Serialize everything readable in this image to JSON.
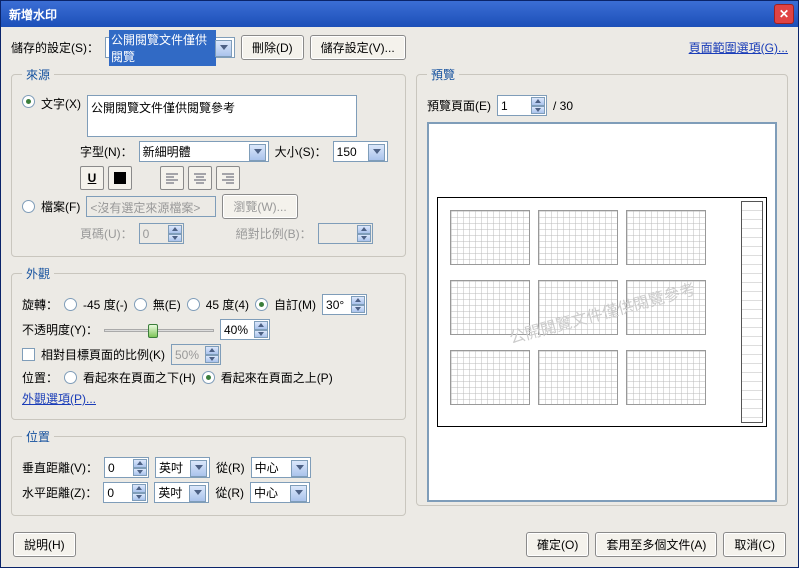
{
  "title": "新增水印",
  "topbar": {
    "saved_label": "儲存的設定(S)：",
    "saved_value": "公開閱覽文件僅供閱覽",
    "delete_btn": "刪除(D)",
    "save_btn": "儲存設定(V)...",
    "page_range_link": "頁面範圍選項(G)..."
  },
  "source": {
    "legend": "來源",
    "text_radio": "文字(X)",
    "text_value": "公開閱覽文件僅供閱覽參考",
    "font_label": "字型(N)：",
    "font_value": "新細明體",
    "size_label": "大小(S)：",
    "size_value": "150",
    "file_radio": "檔案(F)",
    "file_value": "<沒有選定來源檔案>",
    "browse_btn": "瀏覽(W)...",
    "page_label": "頁碼(U)：",
    "page_value": "0",
    "scale_label": "絕對比例(B)：",
    "scale_value": ""
  },
  "appearance": {
    "legend": "外觀",
    "rotate_label": "旋轉：",
    "rot_n45": "-45 度(-)",
    "rot_none": "無(E)",
    "rot_45": "45 度(4)",
    "rot_custom": "自訂(M)",
    "rot_value": "30°",
    "opacity_label": "不透明度(Y)：",
    "opacity_value": "40%",
    "relative_check": "相對目標頁面的比例(K)",
    "relative_value": "50%",
    "location_label": "位置：",
    "loc_behind": "看起來在頁面之下(H)",
    "loc_front": "看起來在頁面之上(P)",
    "appearance_link": "外觀選項(P)..."
  },
  "position": {
    "legend": "位置",
    "vdist_label": "垂直距離(V)：",
    "vdist_value": "0",
    "hdist_label": "水平距離(Z)：",
    "hdist_value": "0",
    "unit": "英吋",
    "from_label": "從(R)",
    "from_value": "中心"
  },
  "preview": {
    "legend": "預覽",
    "page_label": "預覽頁面(E)",
    "page_value": "1",
    "page_total": "/ 30",
    "watermark_text": "公開閱覽文件僅供閱覽參考"
  },
  "buttons": {
    "help": "說明(H)",
    "ok": "確定(O)",
    "apply_multi": "套用至多個文件(A)",
    "cancel": "取消(C)"
  }
}
